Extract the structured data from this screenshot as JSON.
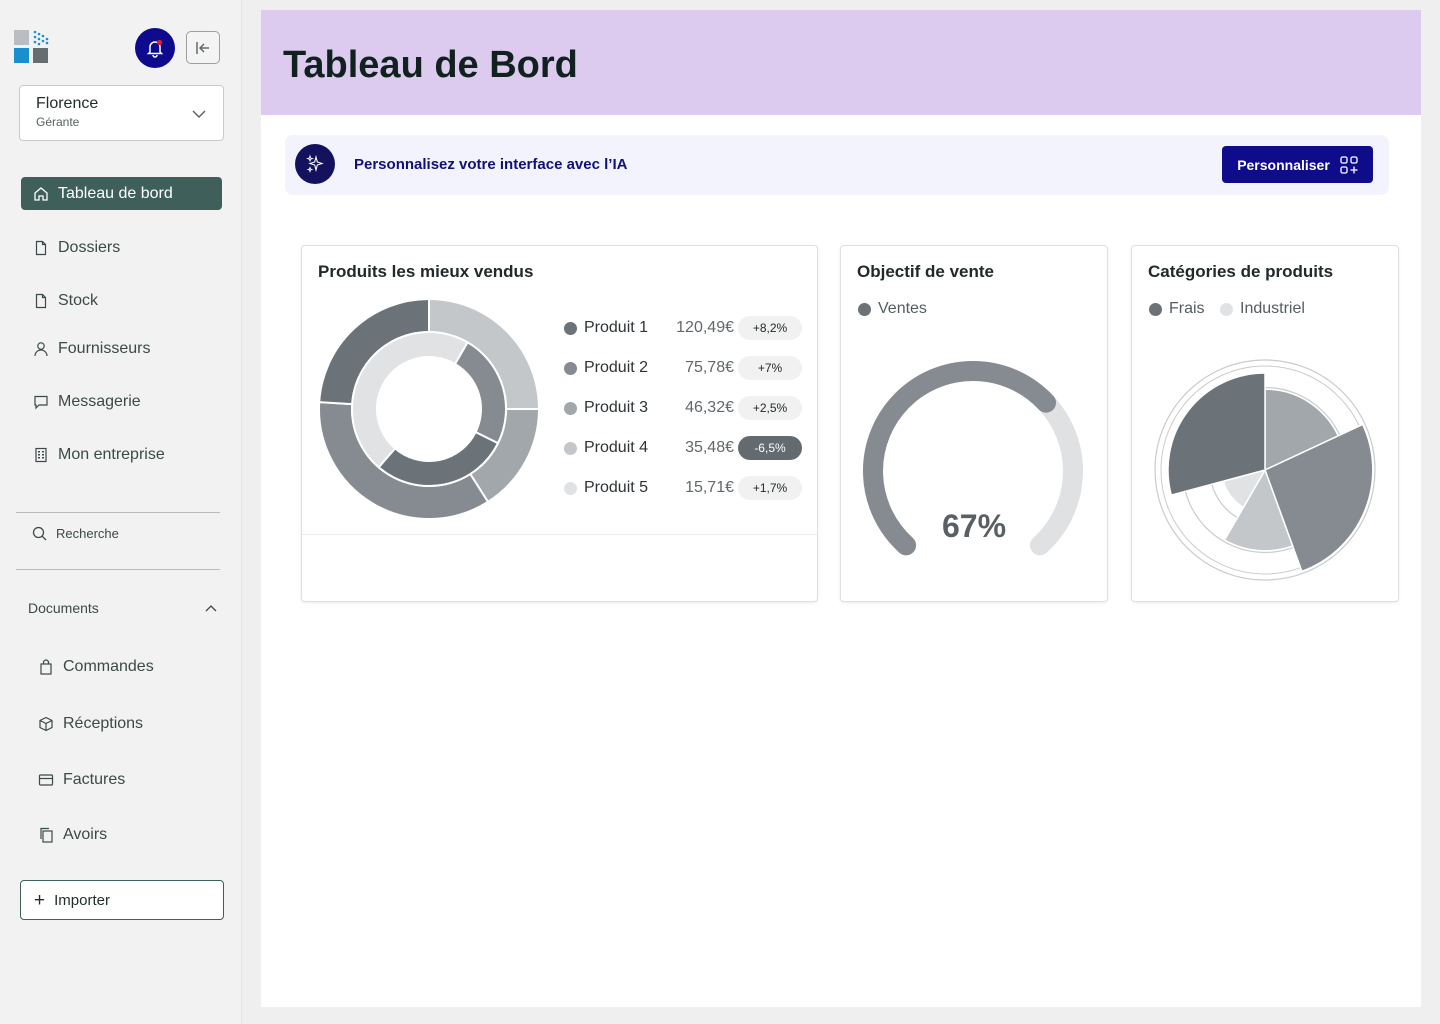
{
  "sidebar": {
    "user": {
      "name": "Florence",
      "role": "Gérante"
    },
    "nav": [
      {
        "label": "Tableau de bord",
        "icon": "home-icon",
        "active": true
      },
      {
        "label": "Dossiers",
        "icon": "file-icon"
      },
      {
        "label": "Stock",
        "icon": "file-icon"
      },
      {
        "label": "Fournisseurs",
        "icon": "user-icon"
      },
      {
        "label": "Messagerie",
        "icon": "message-icon"
      },
      {
        "label": "Mon entreprise",
        "icon": "building-icon"
      }
    ],
    "search_label": "Recherche",
    "documents": {
      "label": "Documents",
      "items": [
        {
          "label": "Commandes",
          "icon": "bag-icon"
        },
        {
          "label": "Réceptions",
          "icon": "box-icon"
        },
        {
          "label": "Factures",
          "icon": "card-icon"
        },
        {
          "label": "Avoirs",
          "icon": "copy-icon"
        }
      ]
    },
    "import_label": "Importer"
  },
  "header": {
    "title": "Tableau de Bord"
  },
  "ai_banner": {
    "text": "Personnalisez votre interface avec l’IA",
    "button": "Personnaliser"
  },
  "colors": {
    "active_nav": "#3f5f5a",
    "header_bg": "#dccbef",
    "primary_button": "#0e0c8a",
    "bell_bg": "#0e0a8e"
  },
  "cards": {
    "top_products": {
      "title": "Produits les mieux vendus",
      "products": [
        {
          "name": "Produit 1",
          "value": "120,49€",
          "change": "+8,2%",
          "negative": false,
          "color": "#6b7278"
        },
        {
          "name": "Produit 2",
          "value": "75,78€",
          "change": "+7%",
          "negative": false,
          "color": "#858b91"
        },
        {
          "name": "Produit 3",
          "value": "46,32€",
          "change": "+2,5%",
          "negative": false,
          "color": "#a2a7ab"
        },
        {
          "name": "Produit 4",
          "value": "35,48€",
          "change": "-6,5%",
          "negative": true,
          "color": "#c4c7ca"
        },
        {
          "name": "Produit 5",
          "value": "15,71€",
          "change": "+1,7%",
          "negative": false,
          "color": "#e0e2e4"
        }
      ]
    },
    "sales_goal": {
      "title": "Objectif de vente",
      "legend": "Ventes",
      "value_label": "67%"
    },
    "categories": {
      "title": "Catégories de produits",
      "legend": [
        "Frais",
        "Industriel"
      ]
    }
  },
  "chart_data": [
    {
      "type": "pie",
      "title": "Produits les mieux vendus",
      "rings": [
        {
          "name": "outer",
          "values": [
            {
              "color": "#c4c7ca",
              "value": 25
            },
            {
              "color": "#a2a7ab",
              "value": 16
            },
            {
              "color": "#858b91",
              "value": 35
            },
            {
              "color": "#6b7278",
              "value": 24
            }
          ]
        },
        {
          "name": "inner",
          "values": [
            {
              "color": "#858b91",
              "value": 24
            },
            {
              "color": "#6b7278",
              "value": 29
            },
            {
              "color": "#e0e2e4",
              "value": 47
            }
          ]
        }
      ]
    },
    {
      "type": "gauge",
      "title": "Objectif de vente",
      "series": [
        {
          "name": "Ventes",
          "value": 0.67
        }
      ]
    },
    {
      "type": "pie",
      "subtype": "polar-area",
      "title": "Catégories de produits",
      "slices": [
        {
          "value": 0.75,
          "color": "#a2a7ab",
          "angle_start": 0,
          "angle_end": 65
        },
        {
          "value": 1.0,
          "color": "#858b91",
          "angle_start": 65,
          "angle_end": 160
        },
        {
          "value": 0.75,
          "color": "#c4c7ca",
          "angle_start": 160,
          "angle_end": 210
        },
        {
          "value": 0.4,
          "color": "#e0e2e4",
          "angle_start": 210,
          "angle_end": 255
        },
        {
          "value": 0.9,
          "color": "#6b7278",
          "angle_start": 255,
          "angle_end": 360
        }
      ]
    }
  ]
}
